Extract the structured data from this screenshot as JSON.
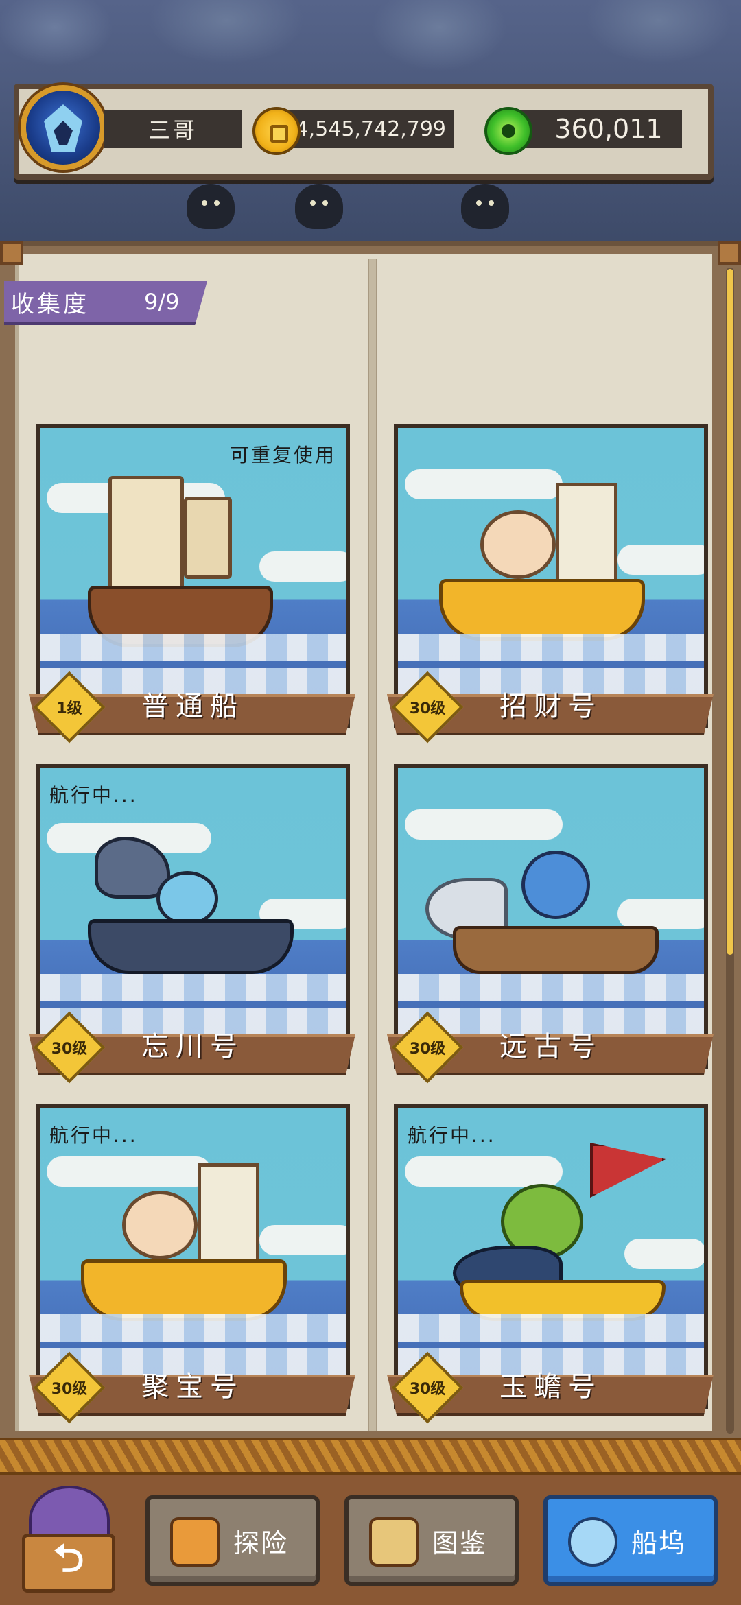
{
  "player": {
    "name": "三哥"
  },
  "resources": {
    "gold": "4,545,742,799",
    "jade": "360,011"
  },
  "collection": {
    "label": "收集度",
    "value": "9/9"
  },
  "ships": [
    {
      "name": "普通船",
      "level": "1级",
      "note": "可重复使用"
    },
    {
      "name": "招财号",
      "level": "30级",
      "note": ""
    },
    {
      "name": "忘川号",
      "level": "30级",
      "note": "航行中..."
    },
    {
      "name": "远古号",
      "level": "30级",
      "note": ""
    },
    {
      "name": "聚宝号",
      "level": "30级",
      "note": "航行中..."
    },
    {
      "name": "玉蟾号",
      "level": "30级",
      "note": "航行中..."
    }
  ],
  "nav": {
    "explore": "探险",
    "atlas": "图鉴",
    "dock": "船坞",
    "active": "dock"
  },
  "icons": {
    "avatar": "winged-crest-icon",
    "gold": "gold-coin-icon",
    "jade": "jade-coin-icon",
    "back": "back-arrow-icon",
    "explore": "explore-icon",
    "atlas": "book-icon",
    "dock": "anchor-icon"
  },
  "colors": {
    "accent_purple": "#7e64a8",
    "active_tab": "#3b8fe6",
    "level_badge": "#f3c638",
    "ribbon": "#8a5a3a"
  }
}
